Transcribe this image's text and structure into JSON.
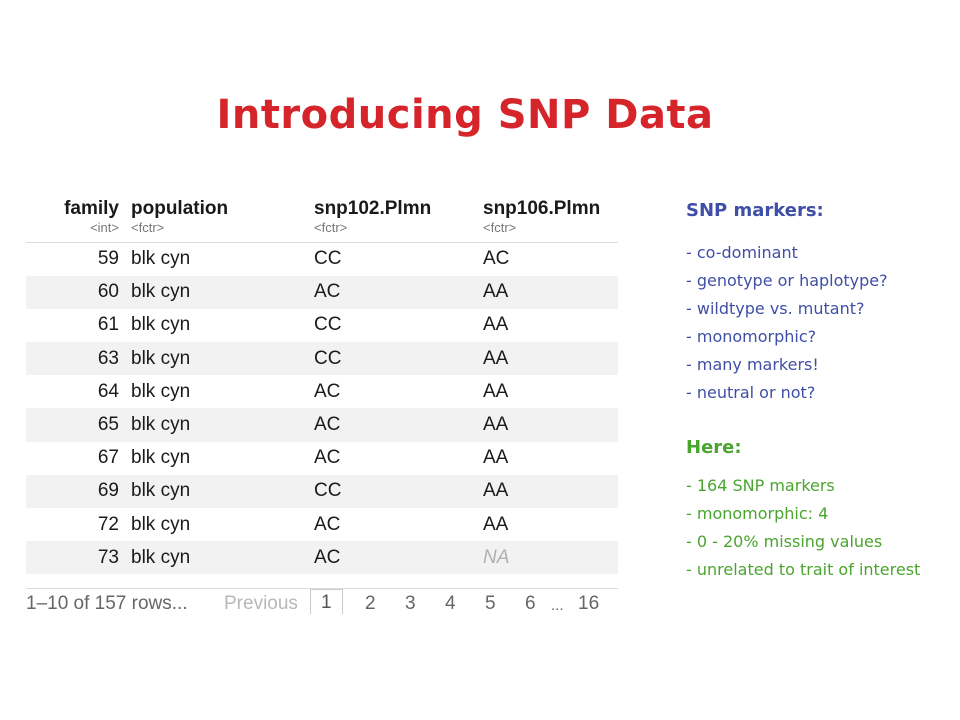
{
  "title": "Introducing SNP Data",
  "table": {
    "columns": [
      {
        "name": "family",
        "type": "<int>"
      },
      {
        "name": "population",
        "type": "<fctr>"
      },
      {
        "name": "snp102.Plmn",
        "type": "<fctr>"
      },
      {
        "name": "snp106.Plmn",
        "type": "<fctr>"
      }
    ],
    "rows": [
      [
        "59",
        "blk cyn",
        "CC",
        "AC"
      ],
      [
        "60",
        "blk cyn",
        "AC",
        "AA"
      ],
      [
        "61",
        "blk cyn",
        "CC",
        "AA"
      ],
      [
        "63",
        "blk cyn",
        "CC",
        "AA"
      ],
      [
        "64",
        "blk cyn",
        "AC",
        "AA"
      ],
      [
        "65",
        "blk cyn",
        "AC",
        "AA"
      ],
      [
        "67",
        "blk cyn",
        "AC",
        "AA"
      ],
      [
        "69",
        "blk cyn",
        "CC",
        "AA"
      ],
      [
        "72",
        "blk cyn",
        "AC",
        "AA"
      ],
      [
        "73",
        "blk cyn",
        "AC",
        "NA"
      ]
    ]
  },
  "pager": {
    "summary": "1–10 of 157 rows...",
    "previous": "Previous",
    "pages": [
      "1",
      "2",
      "3",
      "4",
      "5",
      "6",
      "...",
      "16"
    ],
    "current": "1"
  },
  "markers": {
    "heading": "SNP markers:",
    "items": [
      "- co-dominant",
      "- genotype or haplotype?",
      "- wildtype vs. mutant?",
      "- monomorphic?",
      "- many markers!",
      "- neutral or not?"
    ]
  },
  "here": {
    "heading": "Here:",
    "items": [
      "- 164 SNP markers",
      "- monomorphic: 4",
      "- 0 - 20% missing values",
      "- unrelated to trait of interest"
    ]
  },
  "colors": {
    "title": "#d6252a",
    "markers": "#3f4ea6",
    "here": "#4aa52e"
  }
}
